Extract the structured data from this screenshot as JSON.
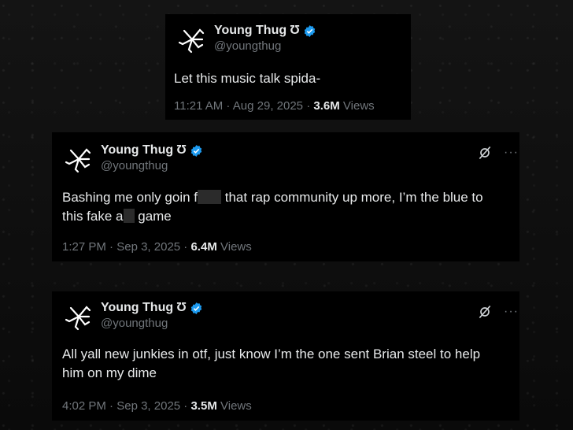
{
  "tweets": [
    {
      "name": "Young Thug",
      "symbol": "Ʊ",
      "handle": "@youngthug",
      "lines": [
        [
          "Let this music talk spida-"
        ]
      ],
      "time": "11:21 AM",
      "date": "Aug 29, 2025",
      "views_count": "3.6M",
      "views_label": "Views",
      "has_actions": false
    },
    {
      "name": "Young Thug",
      "symbol": "Ʊ",
      "handle": "@youngthug",
      "line1a": "Bashing me only goin f",
      "line1b": "that rap community up more, I’m the blue to",
      "line2a": "this fake a",
      "line2b": "game",
      "time": "1:27 PM",
      "date": "Sep 3, 2025",
      "views_count": "6.4M",
      "views_label": "Views",
      "more": "···",
      "has_actions": true
    },
    {
      "name": "Young Thug",
      "symbol": "Ʊ",
      "handle": "@youngthug",
      "line1": "All yall new junkies in otf, just know I’m the one sent Brian steel to help",
      "line2": "him on my dime",
      "time": "4:02 PM",
      "date": "Sep 3, 2025",
      "views_count": "3.5M",
      "views_label": "Views",
      "more": "···",
      "has_actions": true
    }
  ],
  "separator": " · ",
  "icons": {
    "avatar": "spider-logo-icon",
    "verified": "verified-badge-icon",
    "grok": "grok-icon",
    "more": "more-options-icon"
  },
  "colors": {
    "verified": "#1d9bf0",
    "muted": "#71767b",
    "text": "#e7e9ea"
  }
}
